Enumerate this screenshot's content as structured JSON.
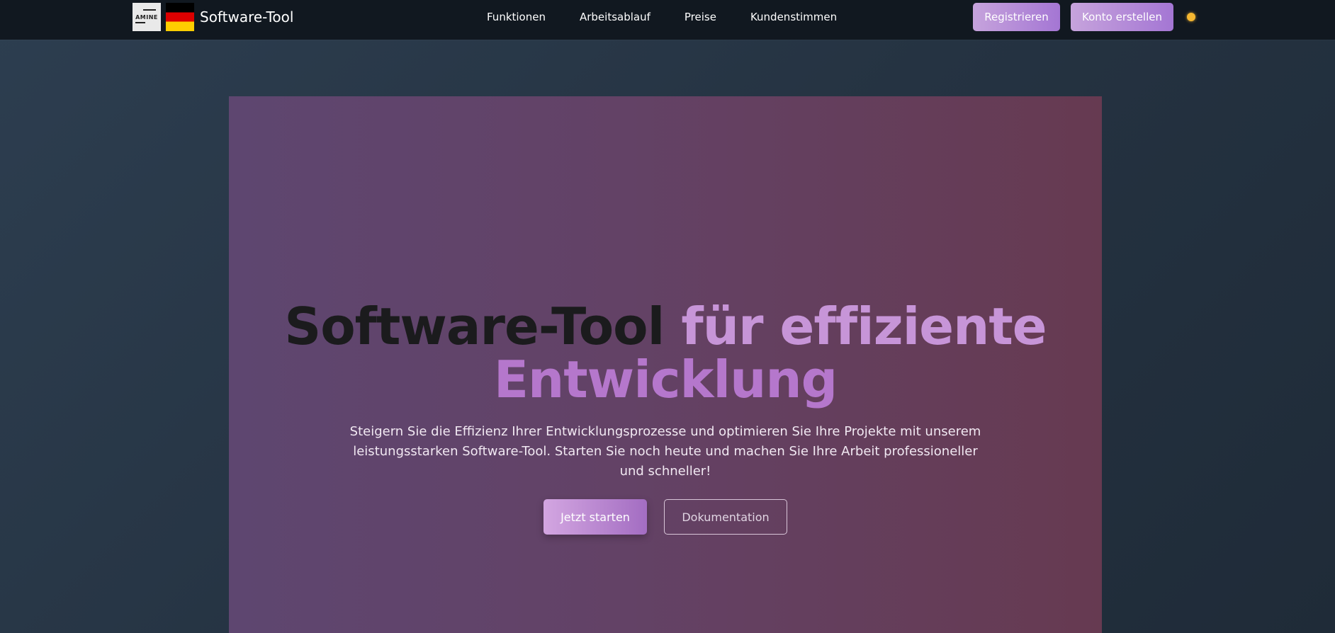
{
  "nav": {
    "logo_text": "AMINE",
    "brand": "Software-Tool",
    "links": [
      {
        "label": "Funktionen"
      },
      {
        "label": "Arbeitsablauf"
      },
      {
        "label": "Preise"
      },
      {
        "label": "Kundenstimmen"
      }
    ],
    "register_label": "Registrieren",
    "create_account_label": "Konto erstellen"
  },
  "hero": {
    "title_dark": "Software-Tool",
    "title_accent_line1": "für effiziente",
    "title_accent_line2": "Entwicklung",
    "subtitle": "Steigern Sie die Effizienz Ihrer Entwicklungsprozesse und optimieren Sie Ihre Projekte mit unserem leistungsstarken Software-Tool. Starten Sie noch heute und machen Sie Ihre Arbeit professioneller und schneller!",
    "primary_button": "Jetzt starten",
    "secondary_button": "Dokumentation"
  },
  "colors": {
    "accent": "#c795d8",
    "button_gradient_start": "#c6a3dc",
    "button_gradient_end": "#a476d4",
    "toggle": "#f5b731"
  }
}
